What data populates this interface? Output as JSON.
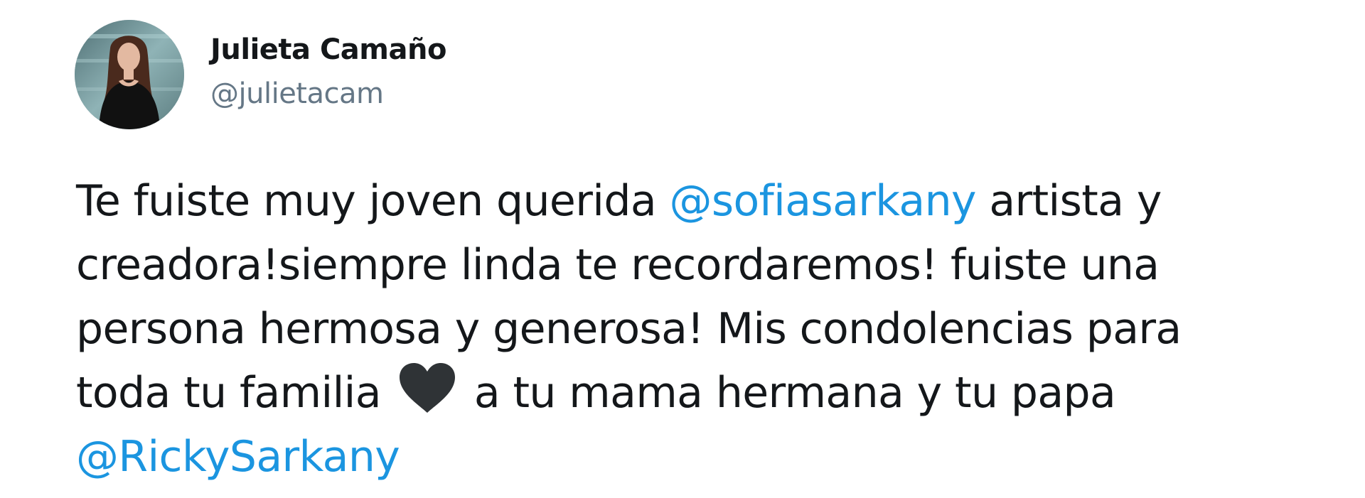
{
  "author": {
    "display_name": "Julieta Camaño",
    "handle": "@julietacam"
  },
  "tweet": {
    "line1_part1": "Te fuiste muy joven querida ",
    "line1_mention": "@sofiasarkany",
    "line1_part2": " artista y",
    "line2": "creadora!siempre linda te recordaremos! fuiste una",
    "line3": "persona hermosa y generosa! Mis condolencias para",
    "line4_part1": "toda tu familia ",
    "line4_emoji": "black-heart-icon",
    "line4_part2": " a tu mama hermana y tu papa",
    "line5_mention": "@RickySarkany"
  },
  "colors": {
    "text": "#14171a",
    "handle": "#657786",
    "mention": "#1b95e0",
    "heart": "#2f3336"
  }
}
